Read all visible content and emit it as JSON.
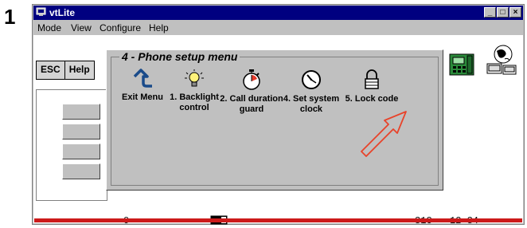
{
  "step_number": "1",
  "window": {
    "title": "vtLite",
    "controls": {
      "minimize": "_",
      "maximize": "□",
      "close": "×"
    }
  },
  "menu": {
    "items": [
      "Mode",
      "View",
      "Configure",
      "Help"
    ]
  },
  "toolbar": {
    "esc_label": "ESC",
    "help_label": "Help"
  },
  "dialog": {
    "title": "4 - Phone setup menu",
    "items": [
      {
        "label": "Exit Menu",
        "icon": "exit-arrow-icon"
      },
      {
        "label": "1. Backlight control",
        "icon": "lightbulb-icon"
      },
      {
        "label": "2. Call duration guard",
        "icon": "stopwatch-icon"
      },
      {
        "label": "4. Set system clock",
        "icon": "clock-icon"
      },
      {
        "label": "5. Lock code",
        "icon": "padlock-icon"
      }
    ],
    "arrow_color": "#e8432a"
  },
  "status": {
    "left": "0",
    "temp": "31C",
    "time": "12 34"
  },
  "accent_red": "#cc1a1a"
}
